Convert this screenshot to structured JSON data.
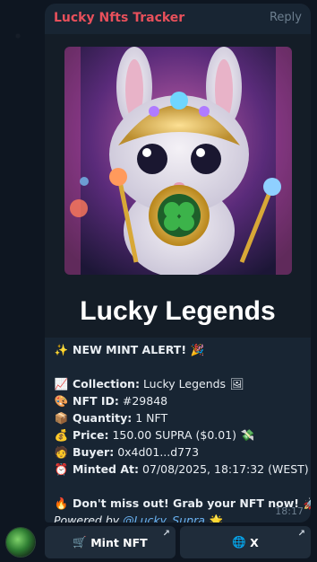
{
  "message": {
    "sender": "Lucky Nfts Tracker",
    "reply_label": "Reply",
    "card_title": "Lucky Legends",
    "time": "18:17",
    "lines": {
      "alert": "NEW MINT ALERT!",
      "collection_label": "Collection:",
      "collection_value": "Lucky Legends",
      "nftid_label": "NFT ID:",
      "nftid_value": "#29848",
      "quantity_label": "Quantity:",
      "quantity_value": "1 NFT",
      "price_label": "Price:",
      "price_value": "150.00 SUPRA ($0.01)",
      "buyer_label": "Buyer:",
      "buyer_value": "0x4d01...d773",
      "minted_label": "Minted At:",
      "minted_value": "07/08/2025, 18:17:32 (WEST)",
      "cta": "Don't miss out! Grab your NFT now!",
      "powered_prefix": "Powered by",
      "powered_link": "@Lucky_Supra"
    }
  },
  "buttons": {
    "mint_label": "Mint NFT",
    "x_label": "X"
  },
  "colors": {
    "sender": "#e8505b",
    "link": "#6ab3f3",
    "bubble": "#182533",
    "background": "#0e1621"
  }
}
